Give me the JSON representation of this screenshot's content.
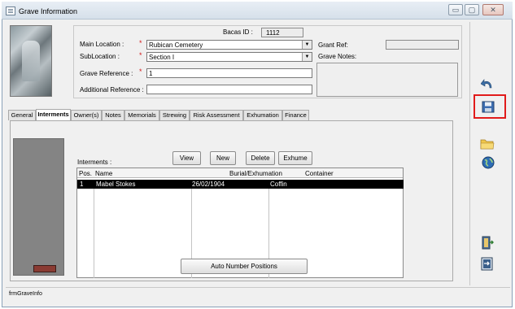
{
  "window": {
    "title": "Grave Information",
    "controls": {
      "minimize": "▭",
      "maximize": "▢",
      "close": "✕"
    }
  },
  "header": {
    "bacas_id_label": "Bacas ID :",
    "bacas_id_value": "1112",
    "main_location_label": "Main Location :",
    "main_location_value": "Rubican Cemetery",
    "sublocation_label": "SubLocation :",
    "sublocation_value": "Section I",
    "grave_reference_label": "Grave Reference :",
    "grave_reference_value": "1",
    "additional_reference_label": "Additional Reference :",
    "additional_reference_value": "",
    "grant_ref_label": "Grant Ref:",
    "grant_ref_value": "",
    "grave_notes_label": "Grave Notes:",
    "required_mark": "*"
  },
  "tabs": [
    {
      "label": "General"
    },
    {
      "label": "Interments"
    },
    {
      "label": "Owner(s)"
    },
    {
      "label": "Notes"
    },
    {
      "label": "Memorials"
    },
    {
      "label": "Strewing"
    },
    {
      "label": "Risk Assessment"
    },
    {
      "label": "Exhumation"
    },
    {
      "label": "Finance"
    }
  ],
  "interments": {
    "label": "Interments :",
    "buttons": {
      "view": "View",
      "new": "New",
      "delete": "Delete",
      "exhume": "Exhume"
    },
    "columns": [
      "Pos.",
      "Name",
      "Burial/Exhumation",
      "Container"
    ],
    "rows": [
      {
        "pos": "1",
        "name": "Mabel Stokes",
        "date": "26/02/1904",
        "container": "Coffin"
      }
    ],
    "auto_number_button": "Auto Number Positions"
  },
  "status": {
    "form_name": "frmGraveInfo"
  },
  "ribbon_icons": [
    "undo-icon",
    "save-icon",
    "folder-icon",
    "globe-icon",
    "exit-door-icon",
    "exit-arrow-icon"
  ],
  "colors": {
    "highlight": "#e11b1b",
    "required": "#d21a1a",
    "selected_row": "#000000"
  }
}
